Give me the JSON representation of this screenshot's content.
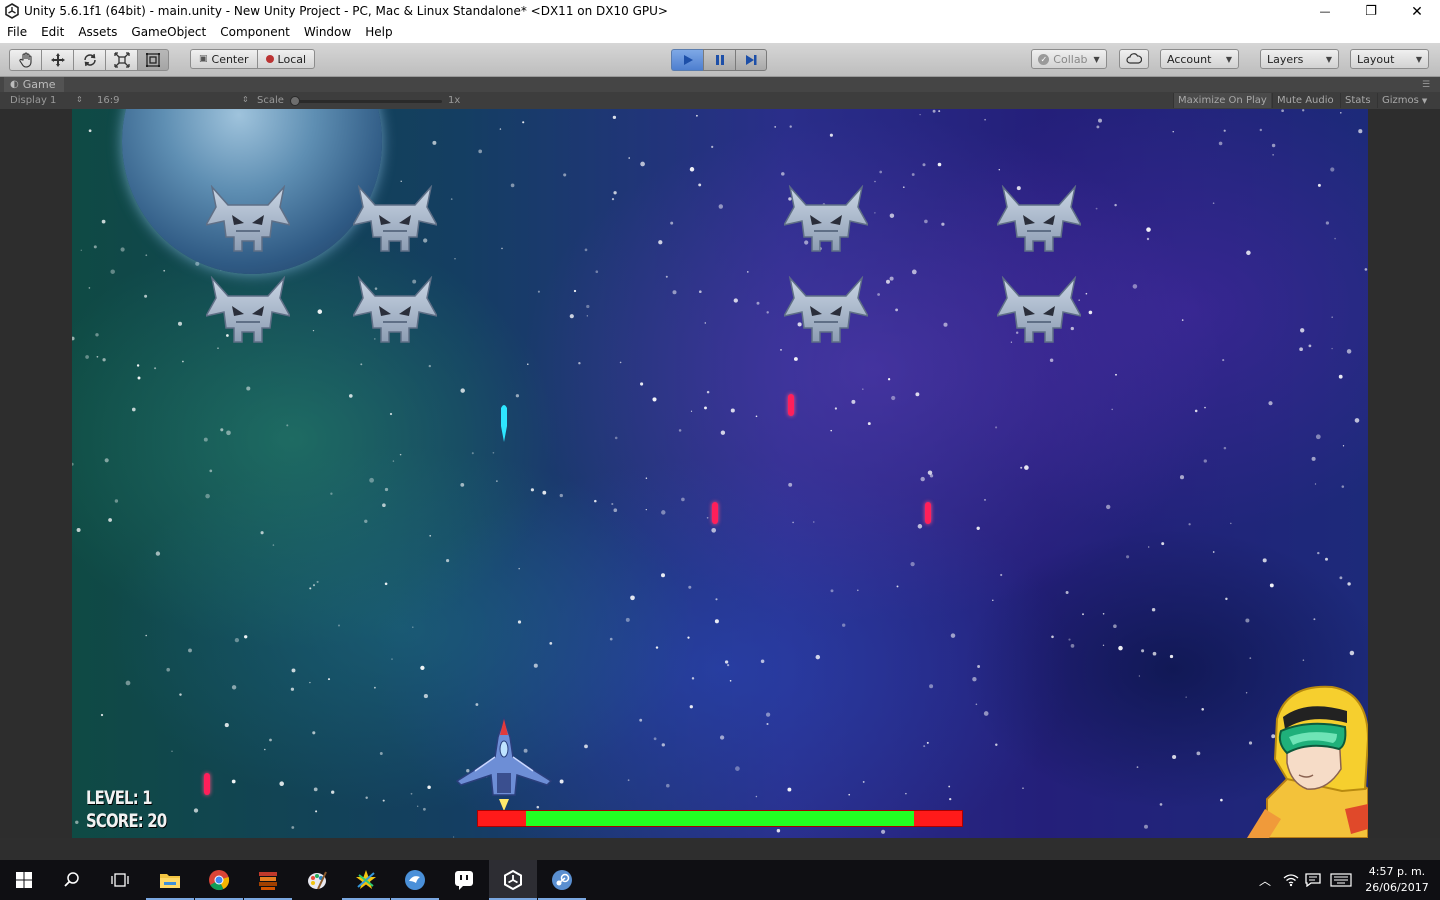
{
  "window": {
    "title": "Unity 5.6.1f1 (64bit) - main.unity - New Unity Project - PC, Mac & Linux Standalone* <DX11 on DX10 GPU>",
    "controls": {
      "minimize": "—",
      "restore": "❐",
      "close": "✕"
    }
  },
  "menu": [
    "File",
    "Edit",
    "Assets",
    "GameObject",
    "Component",
    "Window",
    "Help"
  ],
  "toolbar": {
    "tools": [
      "hand-icon",
      "move-icon",
      "rotate-icon",
      "scale-icon",
      "rect-icon"
    ],
    "pivot_center": "Center",
    "pivot_local": "Local",
    "collab": "Collab",
    "account": "Account",
    "layers": "Layers",
    "layout": "Layout"
  },
  "game_tab": {
    "label": "Game",
    "display": "Display 1",
    "aspect": "16:9",
    "scale_label": "Scale",
    "scale_value": "1x",
    "maximize_on_play": "Maximize On Play",
    "mute_audio": "Mute Audio",
    "stats": "Stats",
    "gizmos": "Gizmos"
  },
  "game": {
    "hud": {
      "level": "LEVEL: 1",
      "score": "SCORE: 20"
    },
    "health": 0.8,
    "colors": {
      "enemy_bullet": "#ff1f5a",
      "player_bullet": "#2ee6ff",
      "health_fill": "#22ff22",
      "health_empty": "#ff1a1a"
    }
  },
  "taskbar": {
    "apps": [
      "windows-start-icon",
      "search-icon",
      "task-view-icon",
      "file-explorer-icon",
      "chrome-icon",
      "book-stack-icon",
      "paint-icon",
      "star-app-icon",
      "dolphin-icon",
      "chat-app-icon",
      "unity-icon",
      "steam-icon"
    ],
    "time": "4:57 p. m.",
    "date": "26/06/2017"
  }
}
